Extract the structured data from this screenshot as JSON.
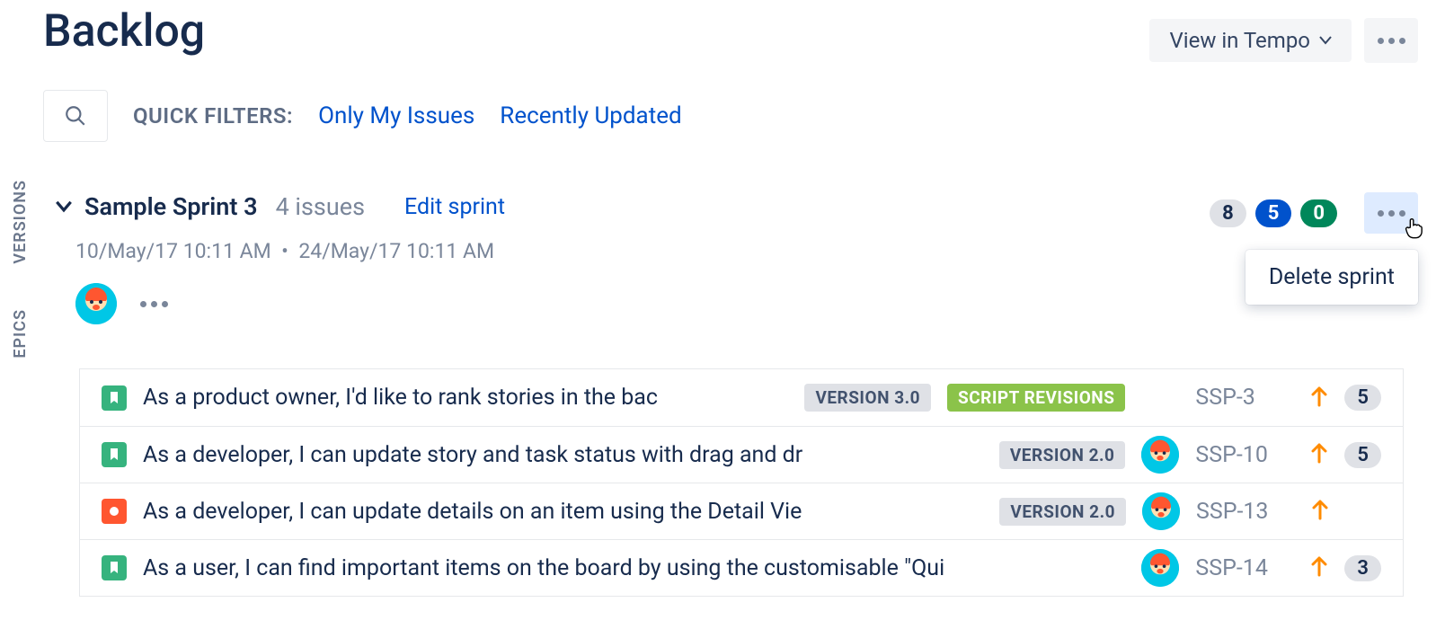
{
  "page_title": "Backlog",
  "view_button": "View in Tempo",
  "quick_filters": {
    "label": "QUICK FILTERS:",
    "items": [
      "Only My Issues",
      "Recently Updated"
    ]
  },
  "side_tabs": [
    "VERSIONS",
    "EPICS"
  ],
  "sprint": {
    "name": "Sample Sprint 3",
    "issue_count": "4 issues",
    "edit_label": "Edit sprint",
    "start": "10/May/17 10:11 AM",
    "end": "24/May/17 10:11 AM",
    "counts": {
      "todo": "8",
      "in_progress": "5",
      "done": "0"
    }
  },
  "menu": {
    "delete": "Delete sprint"
  },
  "issues": [
    {
      "type": "story",
      "summary": "As a product owner, I'd like to rank stories in the bac",
      "version": "VERSION 3.0",
      "epic": "SCRIPT REVISIONS",
      "has_avatar": false,
      "key": "SSP-3",
      "estimate": "5"
    },
    {
      "type": "story",
      "summary": "As a developer, I can update story and task status with drag and dr",
      "version": "VERSION 2.0",
      "epic": null,
      "has_avatar": true,
      "key": "SSP-10",
      "estimate": "5"
    },
    {
      "type": "bug",
      "summary": "As a developer, I can update details on an item using the Detail Vie",
      "version": "VERSION 2.0",
      "epic": null,
      "has_avatar": true,
      "key": "SSP-13",
      "estimate": null
    },
    {
      "type": "story",
      "summary": "As a user, I can find important items on the board by using the customisable \"Qui",
      "version": null,
      "epic": null,
      "has_avatar": true,
      "key": "SSP-14",
      "estimate": "3"
    }
  ]
}
